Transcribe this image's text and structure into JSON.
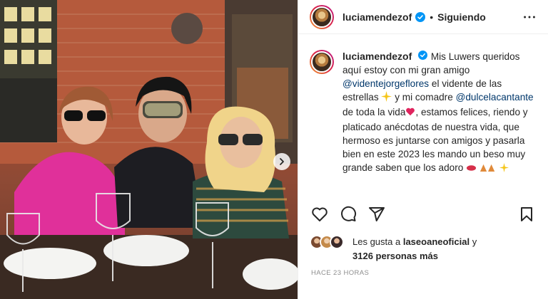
{
  "post": {
    "username": "luciamendezof",
    "separator": "•",
    "follow_state": "Siguiendo",
    "caption": {
      "username": "luciamendezof",
      "text_1": "Mis Luwers queridos aquí estoy con mi gran amigo",
      "mention_1": "@videntejorgeflores",
      "text_2": "el vidente de las estrellas",
      "text_3": "y mi comadre",
      "mention_2": "@dulcelacantante",
      "text_4": "de toda la vida",
      "text_5": ", estamos felices, riendo y platicado anécdotas de nuestra vida, que hermoso es juntarse con amigos y pasarla bien en este 2023 les mando un beso muy grande saben que los adoro"
    },
    "likes": {
      "prefix": "Les gusta a",
      "liked_by": "laseoaneoficial",
      "connector": "y",
      "others": "3126 personas más"
    },
    "timestamp": "Hace 23 horas"
  },
  "icons": {
    "verified": "verified-badge-icon",
    "more": "more-options-icon",
    "like": "heart-icon",
    "comment": "comment-icon",
    "share": "share-icon",
    "save": "bookmark-icon",
    "next": "chevron-right-icon"
  },
  "colors": {
    "verified": "#0095f6",
    "mention": "#00376b",
    "text": "#262626",
    "muted": "#8e8e8e"
  }
}
